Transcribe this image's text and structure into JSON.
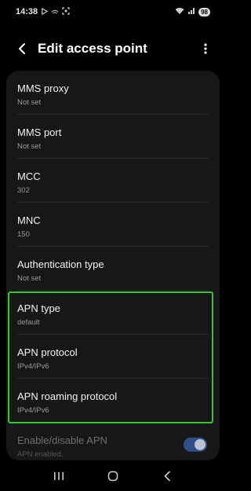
{
  "status_bar": {
    "time": "14:38",
    "left_icons": [
      "play-icon",
      "wifi-calling-icon",
      "screenshot-icon"
    ],
    "right_icons": [
      "wifi-icon",
      "signal-icon"
    ],
    "battery": "98"
  },
  "header": {
    "title": "Edit access point"
  },
  "settings": [
    {
      "title": "MMS proxy",
      "value": "Not set"
    },
    {
      "title": "MMS port",
      "value": "Not set"
    },
    {
      "title": "MCC",
      "value": "302"
    },
    {
      "title": "MNC",
      "value": "150"
    },
    {
      "title": "Authentication type",
      "value": "Not set"
    },
    {
      "title": "APN type",
      "value": "default"
    },
    {
      "title": "APN protocol",
      "value": "IPv4/IPv6"
    },
    {
      "title": "APN roaming protocol",
      "value": "IPv4/IPv6"
    },
    {
      "title": "Enable/disable APN",
      "value": "APN enabled.",
      "toggle": true,
      "disabled": true
    }
  ],
  "highlight_color": "#32c832",
  "nav_bar": [
    "recents-icon",
    "home-icon",
    "back-icon"
  ]
}
